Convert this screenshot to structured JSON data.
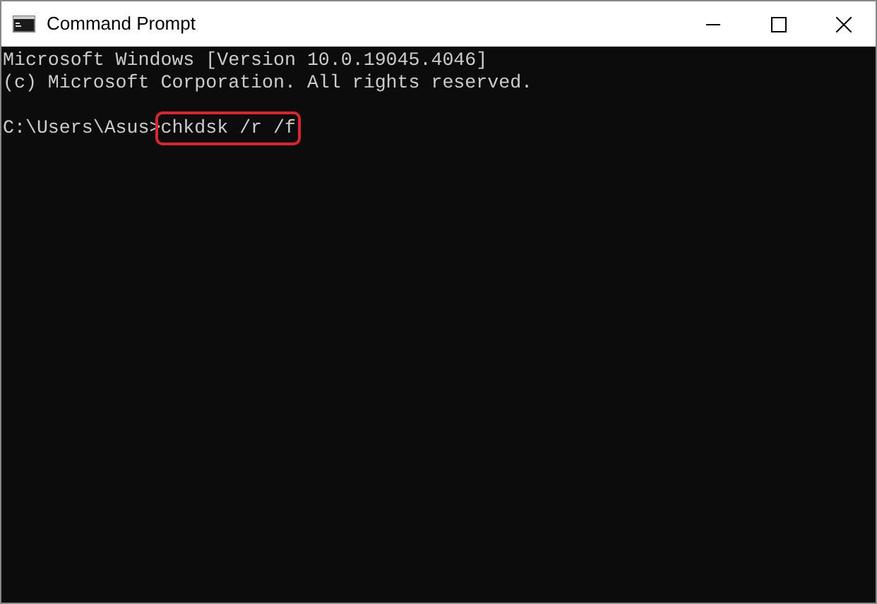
{
  "window": {
    "title": "Command Prompt"
  },
  "console": {
    "lines": [
      {
        "text": "Microsoft Windows [Version 10.0.19045.4046]"
      },
      {
        "text": "(c) Microsoft Corporation. All rights reserved."
      }
    ],
    "blank_line_before_prompt": true,
    "prompt": "C:\\Users\\Asus>",
    "command": "chkdsk /r /f",
    "command_highlighted": true
  }
}
